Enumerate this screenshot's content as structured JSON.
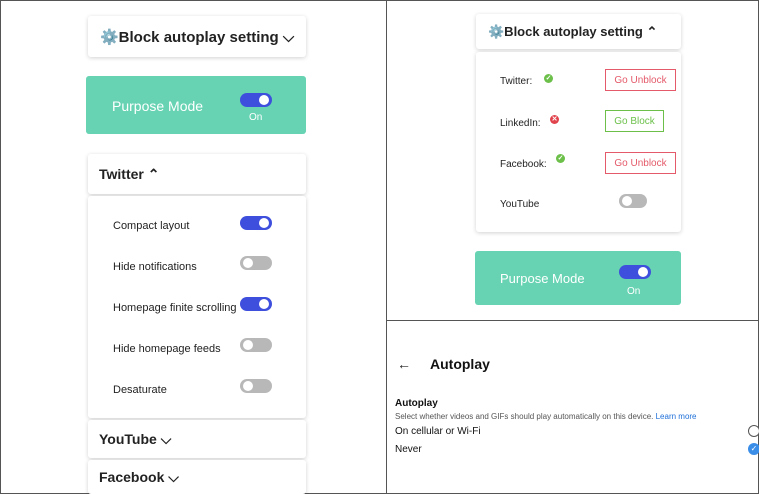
{
  "left": {
    "header_title": "⚙️Block autoplay setting ⌵",
    "header_icon": "gear-icon",
    "purpose_mode": {
      "label": "Purpose Mode",
      "state": "On",
      "enabled": true
    },
    "twitter": {
      "title": "Twitter ⌃",
      "options": [
        {
          "label": "Compact layout",
          "enabled": true
        },
        {
          "label": "Hide notifications",
          "enabled": false
        },
        {
          "label": "Homepage finite scrolling",
          "enabled": true
        },
        {
          "label": "Hide homepage feeds",
          "enabled": false
        },
        {
          "label": "Desaturate",
          "enabled": false
        }
      ]
    },
    "youtube_title": "YouTube ⌵",
    "facebook_title": "Facebook ⌵"
  },
  "right_top": {
    "header_title": "⚙️Block autoplay setting ⌃",
    "rows": [
      {
        "label": "Twitter:",
        "status": "ok",
        "button": "Go Unblock"
      },
      {
        "label": "LinkedIn:",
        "status": "bad",
        "button": "Go Block"
      },
      {
        "label": "Facebook:",
        "status": "ok",
        "button": "Go Unblock"
      },
      {
        "label": "YouTube",
        "toggle_enabled": false
      }
    ],
    "purpose_mode": {
      "label": "Purpose Mode",
      "state": "On",
      "enabled": true
    }
  },
  "right_bottom": {
    "back_icon": "back-arrow-icon",
    "back_glyph": "←",
    "title": "Autoplay",
    "section_title": "Autoplay",
    "description": "Select whether videos and GIFs should play automatically on this device.",
    "learn_more": "Learn more",
    "options": [
      {
        "label": "On cellular or Wi-Fi",
        "selected": false
      },
      {
        "label": "Never",
        "selected": true
      }
    ]
  },
  "colors": {
    "purpose_bg": "#67d3b2",
    "toggle_on": "#3d4fdc",
    "toggle_off": "#b8b8b8",
    "unblock": "#e45a6a",
    "block": "#6cc04a",
    "link": "#1d6fd8"
  }
}
